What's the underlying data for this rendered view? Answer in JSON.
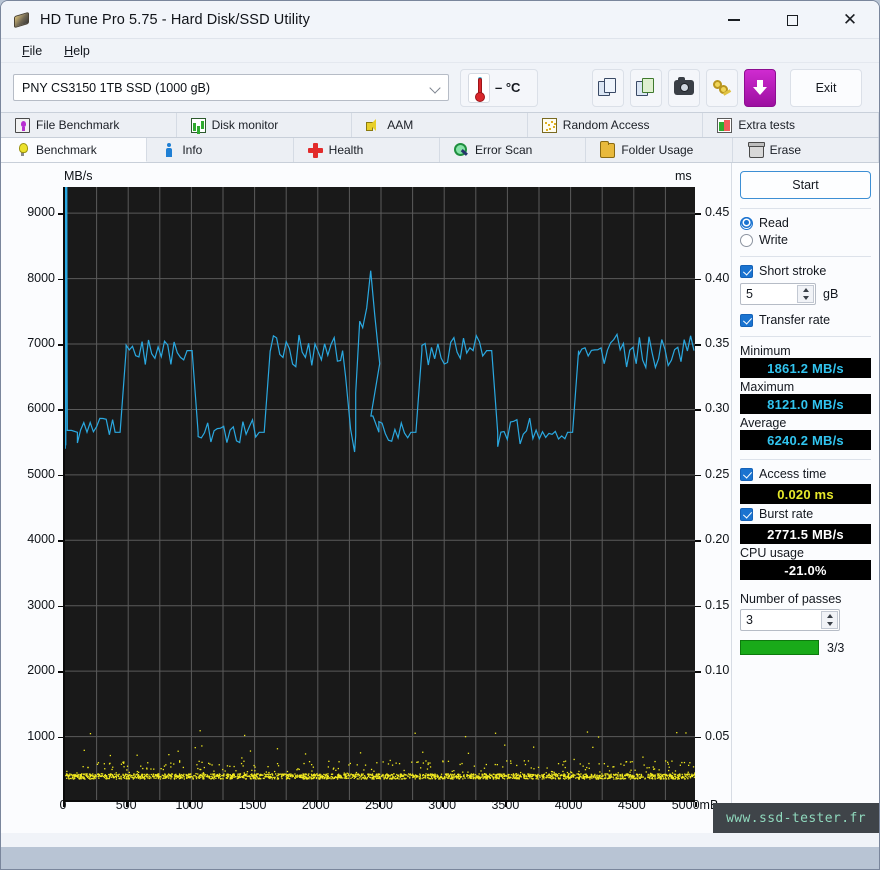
{
  "window": {
    "title": "HD Tune Pro 5.75 - Hard Disk/SSD Utility",
    "icon": "hard-disk-icon",
    "minimize": "—",
    "maximize": "□",
    "close": "✕"
  },
  "menu": {
    "items": [
      "File",
      "Help"
    ]
  },
  "toolbar": {
    "drive": "PNY CS3150 1TB SSD (1000 gB)",
    "temperature": "– °C",
    "buttons": [
      {
        "name": "copy-icon",
        "label": ""
      },
      {
        "name": "copy-green-icon",
        "label": ""
      },
      {
        "name": "camera-icon",
        "label": ""
      },
      {
        "name": "keys-icon",
        "label": ""
      },
      {
        "name": "download-icon",
        "label": ""
      }
    ],
    "exit_label": "Exit"
  },
  "tabs": {
    "row1": [
      {
        "label": "File Benchmark",
        "icon": "file-benchmark-icon"
      },
      {
        "label": "Disk monitor",
        "icon": "disk-monitor-icon"
      },
      {
        "label": "AAM",
        "icon": "speaker-icon"
      },
      {
        "label": "Random Access",
        "icon": "random-access-icon"
      },
      {
        "label": "Extra tests",
        "icon": "extra-tests-icon"
      }
    ],
    "row2": [
      {
        "label": "Benchmark",
        "icon": "bulb-icon",
        "active": true
      },
      {
        "label": "Info",
        "icon": "info-icon",
        "active": false
      },
      {
        "label": "Health",
        "icon": "health-cross-icon",
        "active": false
      },
      {
        "label": "Error Scan",
        "icon": "magnifier-icon",
        "active": false
      },
      {
        "label": "Folder Usage",
        "icon": "folder-icon",
        "active": false
      },
      {
        "label": "Erase",
        "icon": "trash-icon",
        "active": false
      }
    ]
  },
  "panel": {
    "start_label": "Start",
    "mode": {
      "read": "Read",
      "write": "Write",
      "selected": "Read"
    },
    "short_stroke": {
      "label": "Short stroke",
      "checked": true,
      "value": "5",
      "unit": "gB"
    },
    "transfer_rate": {
      "label": "Transfer rate",
      "checked": true
    },
    "minimum": {
      "label": "Minimum",
      "value": "1861.2 MB/s"
    },
    "maximum": {
      "label": "Maximum",
      "value": "8121.0 MB/s"
    },
    "average": {
      "label": "Average",
      "value": "6240.2 MB/s"
    },
    "access_time": {
      "label": "Access time",
      "checked": true,
      "value": "0.020 ms"
    },
    "burst_rate": {
      "label": "Burst rate",
      "checked": true,
      "value": "2771.5 MB/s"
    },
    "cpu_usage": {
      "label": "CPU usage",
      "value": "-21.0%"
    },
    "passes": {
      "label": "Number of passes",
      "value": "3",
      "progress_text": "3/3",
      "progress_pct": 100
    }
  },
  "watermark": "www.ssd-tester.fr",
  "chart_data": {
    "type": "line",
    "title": "",
    "xlabel": "mB",
    "ylabel": "MB/s",
    "y2label": "ms",
    "xlim": [
      0,
      5000
    ],
    "ylim": [
      0,
      9400
    ],
    "y2lim": [
      0,
      0.47
    ],
    "grid": true,
    "legend_position": "none",
    "yticks": [
      1000,
      2000,
      3000,
      4000,
      5000,
      6000,
      7000,
      8000,
      9000
    ],
    "y2ticks": [
      0.05,
      0.1,
      0.15,
      0.2,
      0.25,
      0.3,
      0.35,
      0.4,
      0.45
    ],
    "xticks": [
      0,
      500,
      1000,
      1500,
      2000,
      2500,
      3000,
      3500,
      4000,
      4500,
      5000
    ],
    "colors": {
      "transfer_rate": "#2aa8e0",
      "access_time": "#f2ea1e",
      "plot_bg": "#191919",
      "grid": "#5a5a5a"
    },
    "series": [
      {
        "name": "Transfer rate",
        "unit": "MB/s",
        "axis": "left",
        "color": "#2aa8e0",
        "note": "Square-wave alternation between a ~5650 MB/s low plateau and a ~6900 MB/s high plateau, plus initial burst spikes near 9300 and one peak at 8121.",
        "plateaus": [
          {
            "x_start": 0,
            "x_end": 35,
            "level": 9300,
            "kind": "spike"
          },
          {
            "x_start": 35,
            "x_end": 420,
            "level": 5650,
            "kind": "low"
          },
          {
            "x_start": 420,
            "x_end": 990,
            "level": 6900,
            "kind": "high"
          },
          {
            "x_start": 990,
            "x_end": 1560,
            "level": 5650,
            "kind": "low"
          },
          {
            "x_start": 1560,
            "x_end": 2220,
            "level": 6900,
            "kind": "high"
          },
          {
            "x_start": 2220,
            "x_end": 2300,
            "level": 5450,
            "kind": "dip"
          },
          {
            "x_start": 2300,
            "x_end": 2420,
            "level": 8121,
            "kind": "peak"
          },
          {
            "x_start": 2420,
            "x_end": 2760,
            "level": 5650,
            "kind": "low"
          },
          {
            "x_start": 2760,
            "x_end": 3360,
            "level": 6900,
            "kind": "high"
          },
          {
            "x_start": 3360,
            "x_end": 4000,
            "level": 5650,
            "kind": "low"
          },
          {
            "x_start": 4000,
            "x_end": 5000,
            "level": 6900,
            "kind": "high"
          }
        ],
        "minimum": 1861.2,
        "maximum": 8121.0,
        "average": 6240.2
      },
      {
        "name": "Access time",
        "unit": "ms",
        "axis": "right",
        "color": "#f2ea1e",
        "note": "Dense scatter band centered at about 0.020 ms across the full 0-5000 mB span, with sparse outliers up to ~0.055 ms.",
        "center": 0.02,
        "spread": 0.004,
        "outlier_max": 0.055
      }
    ]
  }
}
